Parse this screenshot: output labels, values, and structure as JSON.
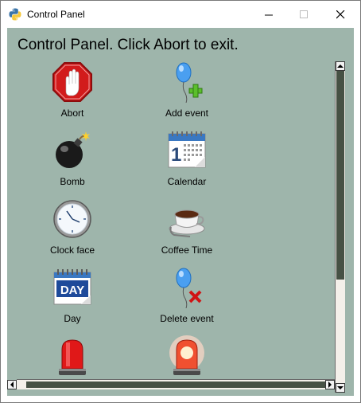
{
  "window": {
    "title": "Control Panel"
  },
  "heading": "Control Panel. Click Abort to exit.",
  "items": [
    {
      "label": "Abort",
      "icon": "stop-hand-icon"
    },
    {
      "label": "Add event",
      "icon": "balloon-add-icon"
    },
    {
      "label": "Bomb",
      "icon": "bomb-icon"
    },
    {
      "label": "Calendar",
      "icon": "calendar-icon"
    },
    {
      "label": "Clock face",
      "icon": "clock-face-icon"
    },
    {
      "label": "Coffee Time",
      "icon": "coffee-cup-icon"
    },
    {
      "label": "Day",
      "icon": "day-calendar-icon"
    },
    {
      "label": "Delete event",
      "icon": "balloon-delete-icon"
    },
    {
      "label": "",
      "icon": "red-siren-icon"
    },
    {
      "label": "",
      "icon": "glowing-siren-icon"
    }
  ],
  "colors": {
    "background": "#9eb5ab",
    "scroll_thumb": "#465144"
  }
}
